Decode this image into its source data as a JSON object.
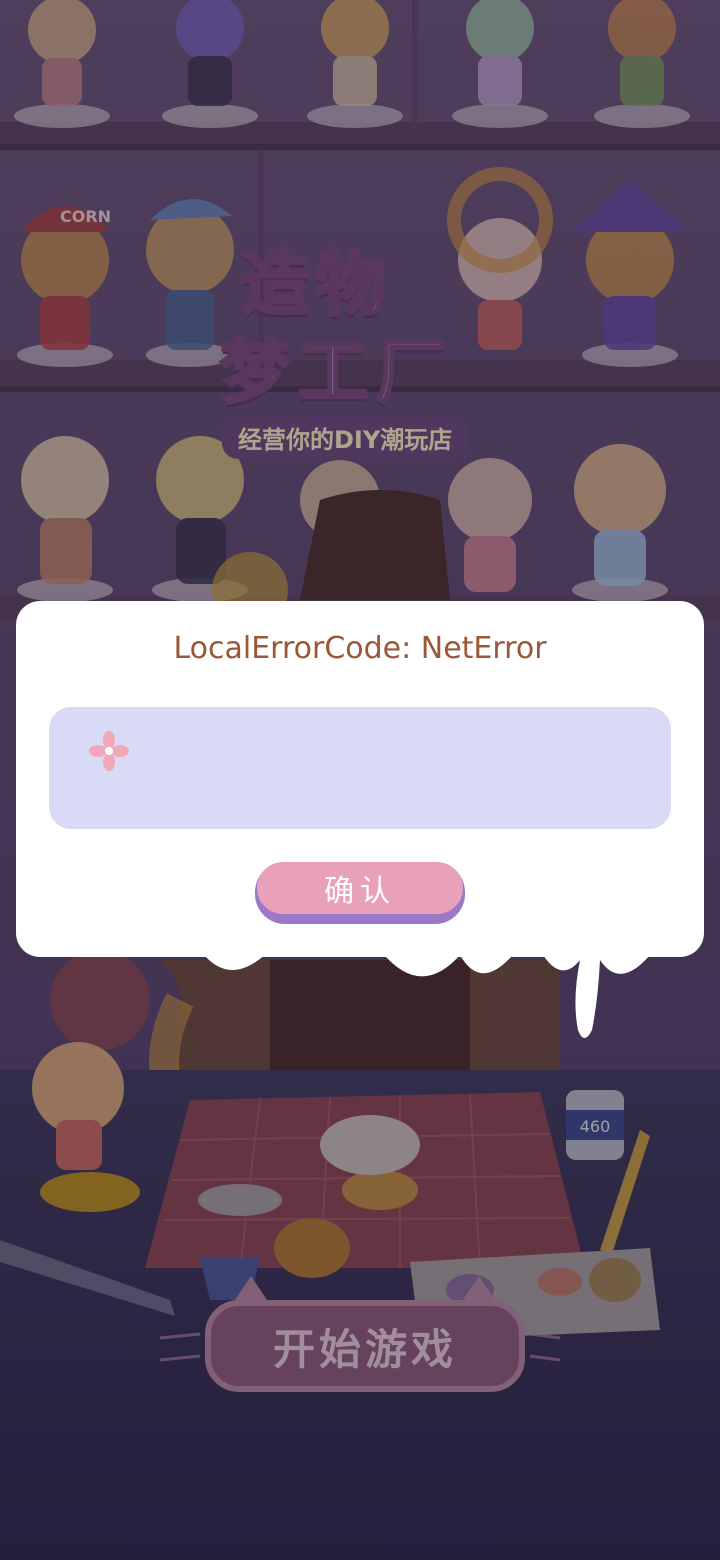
{
  "background": {
    "logo": {
      "line1": "造物",
      "line2": "梦工厂",
      "subtitle": "经营你的DIY潮玩店"
    },
    "start_button_label": "开始游戏",
    "glue_bottle_label": "460",
    "cap_text": "CORN"
  },
  "dialog": {
    "title": "LocalErrorCode: NetError",
    "message": "",
    "confirm_label": "确认"
  },
  "colors": {
    "dialog_bg": "#ffffff",
    "title": "#9a5838",
    "message_box": "#d9dbf6",
    "confirm_button": "#e8a0bb",
    "confirm_shadow": "#9a7ac8"
  }
}
